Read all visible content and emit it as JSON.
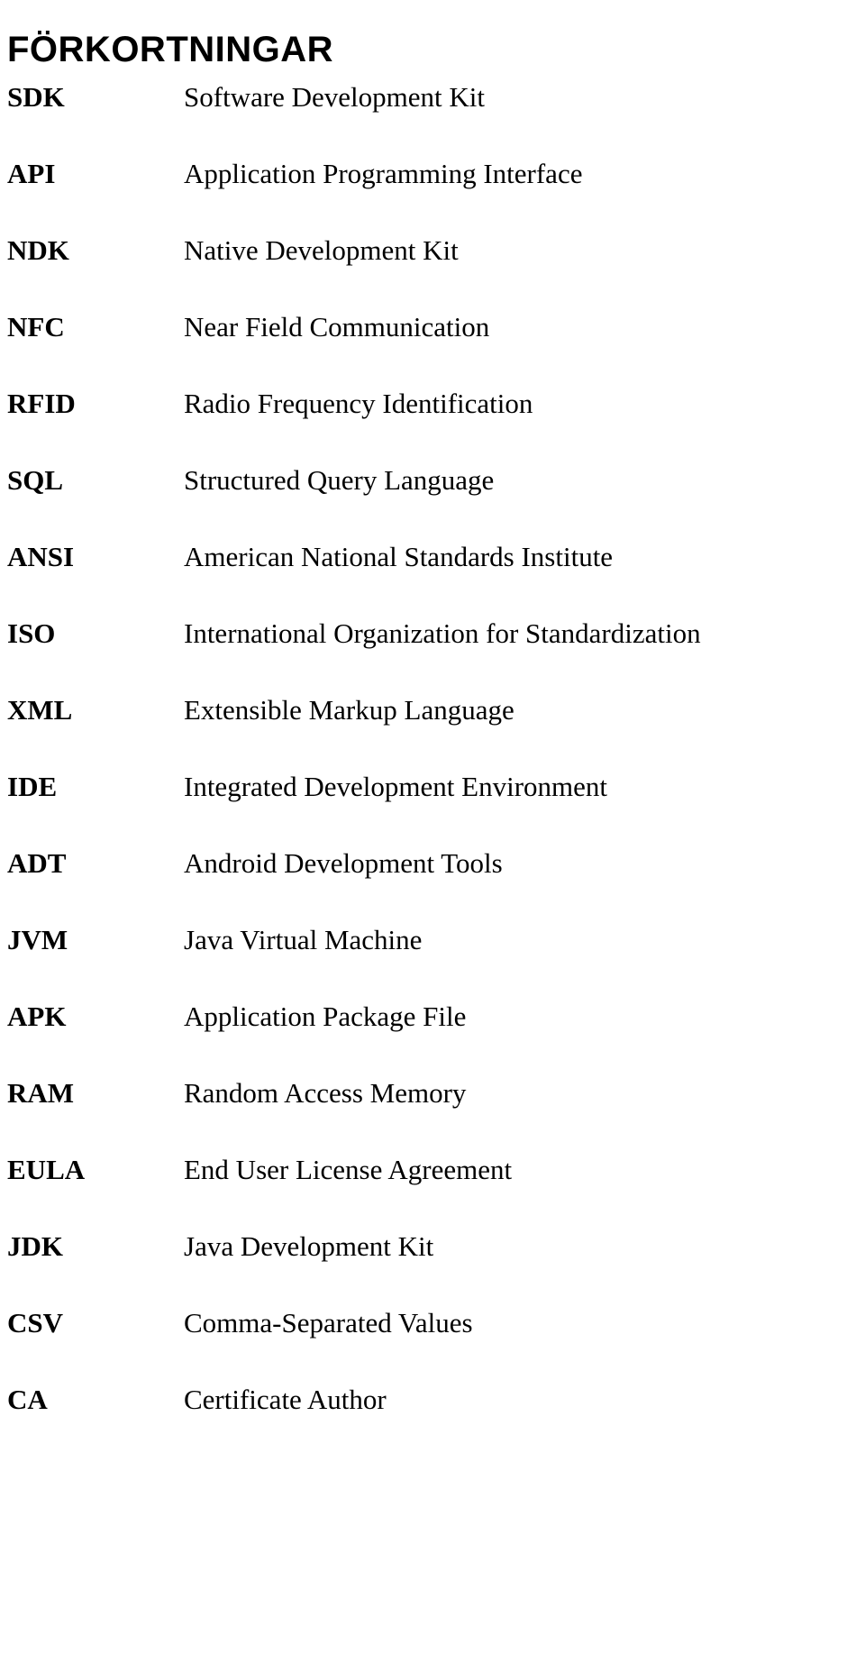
{
  "document": {
    "title": "FÖRKORTNINGAR",
    "abbreviations": [
      {
        "term": "SDK",
        "definition": "Software Development Kit"
      },
      {
        "term": "API",
        "definition": "Application Programming Interface"
      },
      {
        "term": "NDK",
        "definition": "Native Development Kit"
      },
      {
        "term": "NFC",
        "definition": "Near Field Communication"
      },
      {
        "term": "RFID",
        "definition": "Radio Frequency Identification"
      },
      {
        "term": "SQL",
        "definition": "Structured Query Language"
      },
      {
        "term": "ANSI",
        "definition": "American National Standards Institute"
      },
      {
        "term": "ISO",
        "definition": "International Organization for Standardization"
      },
      {
        "term": "XML",
        "definition": "Extensible Markup Language"
      },
      {
        "term": "IDE",
        "definition": "Integrated Development Environment"
      },
      {
        "term": "ADT",
        "definition": "Android Development Tools"
      },
      {
        "term": "JVM",
        "definition": "Java Virtual Machine"
      },
      {
        "term": "APK",
        "definition": "Application Package File"
      },
      {
        "term": "RAM",
        "definition": "Random Access Memory"
      },
      {
        "term": "EULA",
        "definition": "End User License Agreement"
      },
      {
        "term": "JDK",
        "definition": "Java Development Kit"
      },
      {
        "term": "CSV",
        "definition": "Comma-Separated Values"
      },
      {
        "term": "CA",
        "definition": "Certificate Author"
      }
    ]
  }
}
